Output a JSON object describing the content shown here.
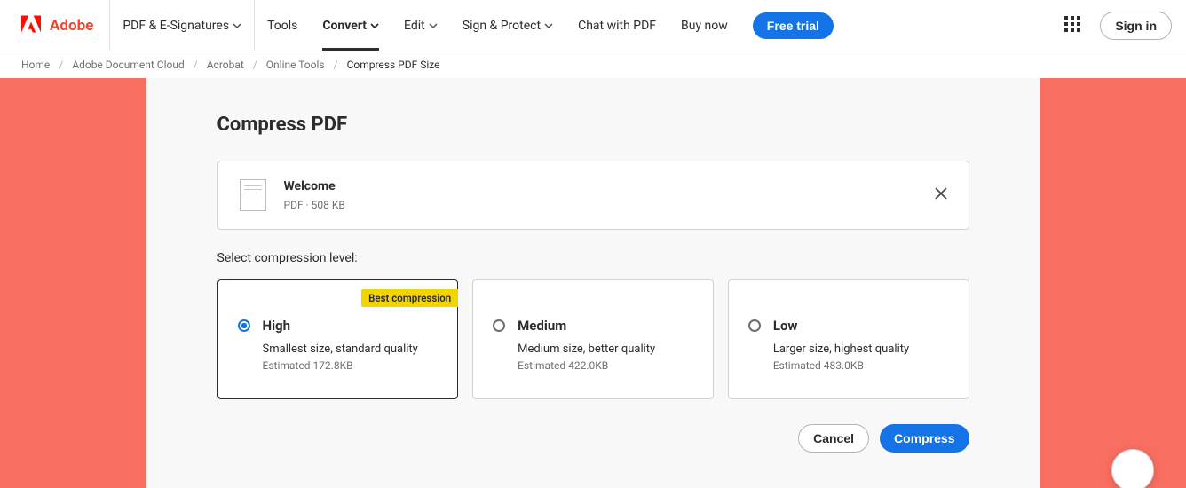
{
  "header": {
    "brand": "Adobe",
    "nav": {
      "pdf_esign": "PDF & E-Signatures",
      "tools": "Tools",
      "convert": "Convert",
      "edit": "Edit",
      "sign_protect": "Sign & Protect",
      "chat": "Chat with PDF",
      "buy_now": "Buy now",
      "free_trial": "Free trial"
    },
    "sign_in": "Sign in"
  },
  "breadcrumb": {
    "home": "Home",
    "adc": "Adobe Document Cloud",
    "acrobat": "Acrobat",
    "online_tools": "Online Tools",
    "current": "Compress PDF Size"
  },
  "main": {
    "title": "Compress PDF",
    "file": {
      "name": "Welcome",
      "meta": "PDF · 508 KB"
    },
    "section_label": "Select compression level:",
    "options": {
      "high": {
        "badge": "Best compression",
        "label": "High",
        "desc": "Smallest size, standard quality",
        "est": "Estimated 172.8KB"
      },
      "medium": {
        "label": "Medium",
        "desc": "Medium size, better quality",
        "est": "Estimated 422.0KB"
      },
      "low": {
        "label": "Low",
        "desc": "Larger size, highest quality",
        "est": "Estimated 483.0KB"
      }
    },
    "actions": {
      "cancel": "Cancel",
      "compress": "Compress"
    }
  }
}
